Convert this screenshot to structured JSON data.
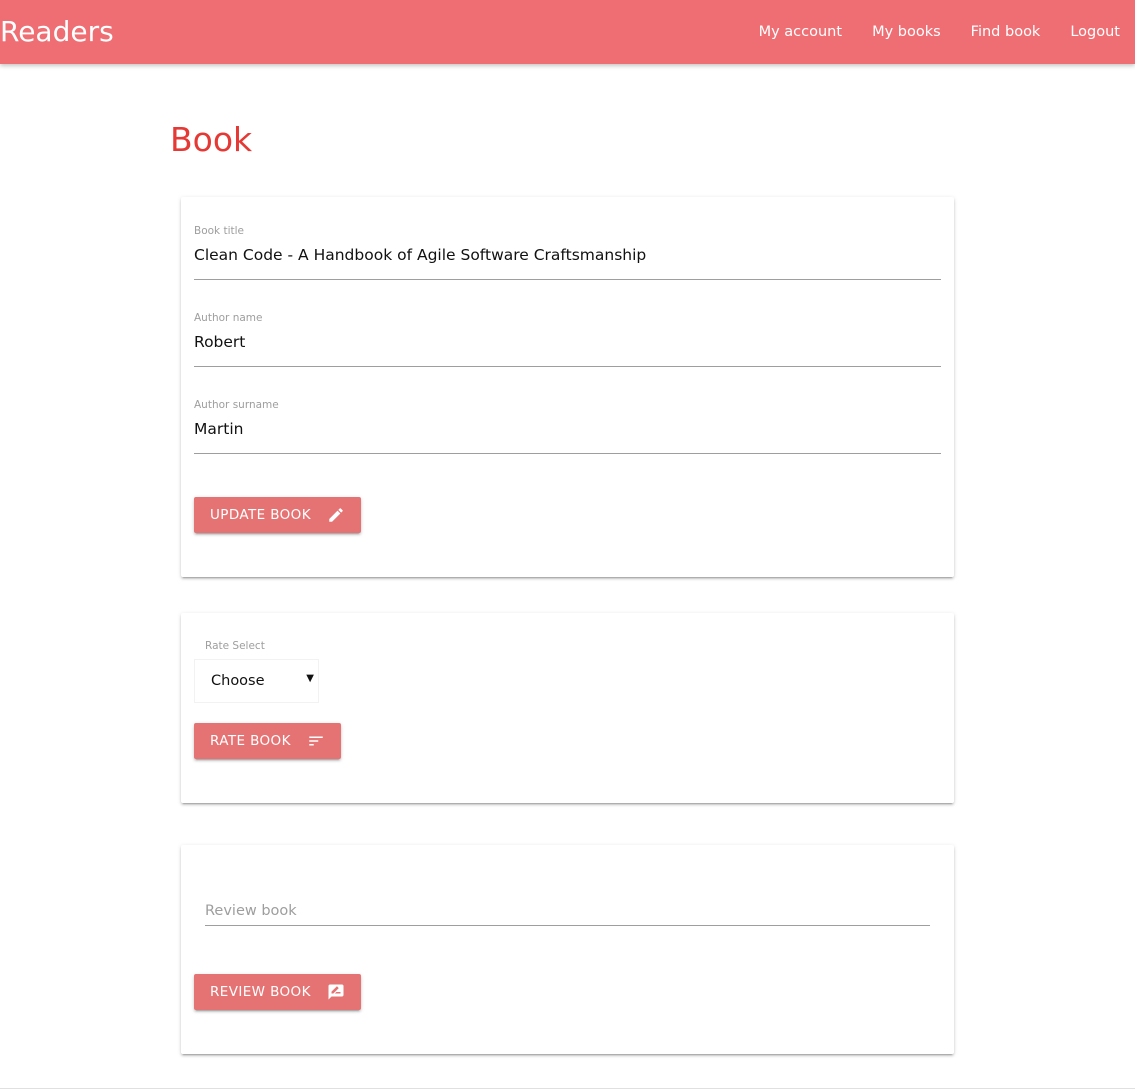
{
  "app": {
    "brand": "Readers"
  },
  "nav": {
    "links": [
      {
        "label": "My account"
      },
      {
        "label": "My books"
      },
      {
        "label": "Find book"
      },
      {
        "label": "Logout"
      }
    ]
  },
  "page": {
    "title": "Book"
  },
  "book_form": {
    "title_label": "Book title",
    "title_value": "Clean Code - A Handbook of Agile Software Craftsmanship",
    "author_name_label": "Author name",
    "author_name_value": "Robert",
    "author_surname_label": "Author surname",
    "author_surname_value": "Martin",
    "update_button": "Update book",
    "update_icon": "pencil-icon"
  },
  "rate_form": {
    "select_label": "Rate Select",
    "select_value": "Choose",
    "rate_button": "Rate book",
    "rate_icon": "sort-icon"
  },
  "review_form": {
    "placeholder": "Review book",
    "review_button": "Review book",
    "review_icon": "rate-review-icon"
  },
  "colors": {
    "navbar": "#ef6e73",
    "title": "#e53935",
    "button": "#e57373"
  }
}
